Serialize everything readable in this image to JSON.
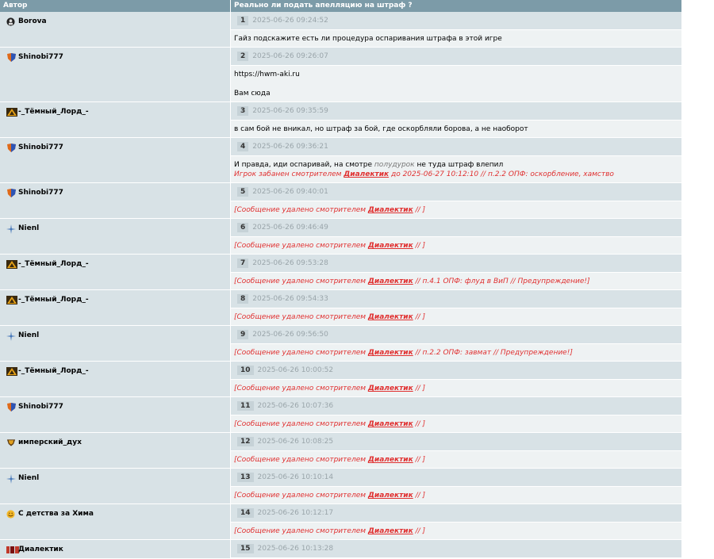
{
  "header": {
    "author_col": "Автор",
    "topic_title": "Реально ли подать апелляцию на штраф ?"
  },
  "posts": [
    {
      "author": "Borova",
      "icon": "black-circle-avatar-icon",
      "num": "1",
      "date": "2025-06-26 09:24:52",
      "lines": [
        "Гайз подскажите есть ли процедура оспаривания штрафа в этой игре"
      ]
    },
    {
      "author": "Shinobi777",
      "icon": "clan-shield-icon",
      "num": "2",
      "date": "2025-06-26 09:26:07",
      "lines": [
        "https://hwm-aki.ru",
        "Вам сюда"
      ]
    },
    {
      "author": "-_Тёмный_Лорд_-",
      "icon": "triangle-emblem-icon",
      "num": "3",
      "date": "2025-06-26 09:35:59",
      "lines": [
        "в сам бой не вникал, но штраф за бой, где оскорбляли борова, а не наоборот"
      ]
    },
    {
      "author": "Shinobi777",
      "icon": "clan-shield-icon",
      "num": "4",
      "date": "2025-06-26 09:36:21",
      "text_a": "И правда, иди оспаривай, на смотре ",
      "text_em": "полудурок",
      "text_b": " не туда штраф влепил",
      "ban_a": "Игрок забанен смотрителем ",
      "ban_mod": "Диалектик",
      "ban_b": " до 2025-06-27 10:12:10 // п.2.2 ОПФ: оскорбление, хамство"
    },
    {
      "author": "Shinobi777",
      "icon": "clan-shield-icon",
      "num": "5",
      "date": "2025-06-26 09:40:01",
      "del_a": "[Сообщение удалено смотрителем ",
      "del_mod": "Диалектик",
      "del_b": " // ]"
    },
    {
      "author": "Nienl",
      "icon": "star-cross-icon",
      "num": "6",
      "date": "2025-06-26 09:46:49",
      "del_a": "[Сообщение удалено смотрителем ",
      "del_mod": "Диалектик",
      "del_b": " // ]"
    },
    {
      "author": "-_Тёмный_Лорд_-",
      "icon": "triangle-emblem-icon",
      "num": "7",
      "date": "2025-06-26 09:53:28",
      "del_a": "[Сообщение удалено смотрителем ",
      "del_mod": "Диалектик",
      "del_b": " // п.4.1 ОПФ: флуд в ВиП // Предупреждение!]"
    },
    {
      "author": "-_Тёмный_Лорд_-",
      "icon": "triangle-emblem-icon",
      "num": "8",
      "date": "2025-06-26 09:54:33",
      "del_a": "[Сообщение удалено смотрителем ",
      "del_mod": "Диалектик",
      "del_b": " // ]"
    },
    {
      "author": "Nienl",
      "icon": "star-cross-icon",
      "num": "9",
      "date": "2025-06-26 09:56:50",
      "del_a": "[Сообщение удалено смотрителем ",
      "del_mod": "Диалектик",
      "del_b": " // п.2.2 ОПФ: завмат // Предупреждение!]"
    },
    {
      "author": "-_Тёмный_Лорд_-",
      "icon": "triangle-emblem-icon",
      "num": "10",
      "date": "2025-06-26 10:00:52",
      "del_a": "[Сообщение удалено смотрителем ",
      "del_mod": "Диалектик",
      "del_b": " // ]"
    },
    {
      "author": "Shinobi777",
      "icon": "clan-shield-icon",
      "num": "11",
      "date": "2025-06-26 10:07:36",
      "del_a": "[Сообщение удалено смотрителем ",
      "del_mod": "Диалектик",
      "del_b": " // ]"
    },
    {
      "author": "имперский_дух",
      "icon": "imperial-crest-icon",
      "num": "12",
      "date": "2025-06-26 10:08:25",
      "del_a": "[Сообщение удалено смотрителем ",
      "del_mod": "Диалектик",
      "del_b": " // ]"
    },
    {
      "author": "Nienl",
      "icon": "star-cross-icon",
      "num": "13",
      "date": "2025-06-26 10:10:14",
      "del_a": "[Сообщение удалено смотрителем ",
      "del_mod": "Диалектик",
      "del_b": " // ]"
    },
    {
      "author": "С детства за Хима",
      "icon": "smiley-icon",
      "num": "14",
      "date": "2025-06-26 10:12:17",
      "del_a": "[Сообщение удалено смотрителем ",
      "del_mod": "Диалектик",
      "del_b": " // ]"
    },
    {
      "author": "Диалектик",
      "icon": "moderator-badge-icon",
      "num": "15",
      "date": "2025-06-26 10:13:28"
    }
  ]
}
